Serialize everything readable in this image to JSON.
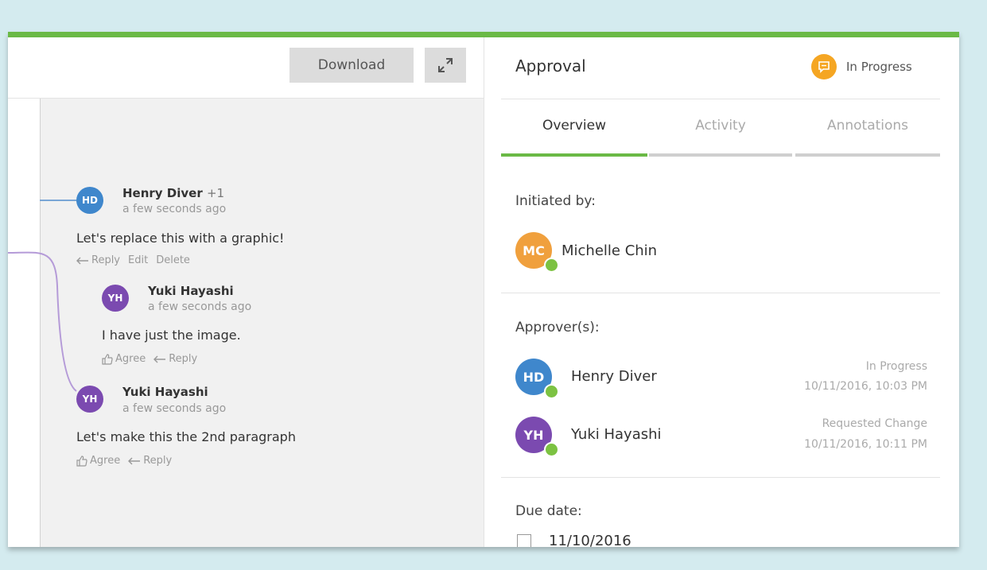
{
  "toolbar": {
    "download_label": "Download",
    "expand_icon": "expand-icon"
  },
  "comments": [
    {
      "initials": "HD",
      "name": "Henry Diver",
      "extra": "+1",
      "time": "a few seconds ago",
      "text": "Let's replace this with a graphic!",
      "actions": {
        "reply": "Reply",
        "edit": "Edit",
        "delete": "Delete"
      },
      "color": "#3f87cc"
    },
    {
      "initials": "YH",
      "name": "Yuki Hayashi",
      "time": "a few seconds ago",
      "text": "I have just the image.",
      "actions": {
        "agree": "Agree",
        "reply": "Reply"
      },
      "color": "#7b4ab0"
    },
    {
      "initials": "YH",
      "name": "Yuki Hayashi",
      "time": "a few seconds ago",
      "text": "Let's make this the 2nd paragraph",
      "actions": {
        "agree": "Agree",
        "reply": "Reply"
      },
      "color": "#7b4ab0"
    }
  ],
  "approval": {
    "title": "Approval",
    "status": "In Progress",
    "status_color": "#f5a623",
    "tabs": [
      {
        "label": "Overview",
        "active": true
      },
      {
        "label": "Activity",
        "active": false
      },
      {
        "label": "Annotations",
        "active": false
      }
    ],
    "initiated_label": "Initiated by:",
    "initiator": {
      "initials": "MC",
      "name": "Michelle Chin",
      "color": "#f0a03d"
    },
    "approvers_label": "Approver(s):",
    "approvers": [
      {
        "initials": "HD",
        "name": "Henry Diver",
        "status": "In Progress",
        "date": "10/11/2016, 10:03 PM",
        "color": "#3f87cc"
      },
      {
        "initials": "YH",
        "name": "Yuki Hayashi",
        "status": "Requested Change",
        "date": "10/11/2016, 10:11 PM",
        "color": "#7b4ab0"
      }
    ],
    "due_label": "Due date:",
    "due_date": "11/10/2016"
  },
  "colors": {
    "accent_green": "#6ab945",
    "presence_green": "#7cc242"
  }
}
